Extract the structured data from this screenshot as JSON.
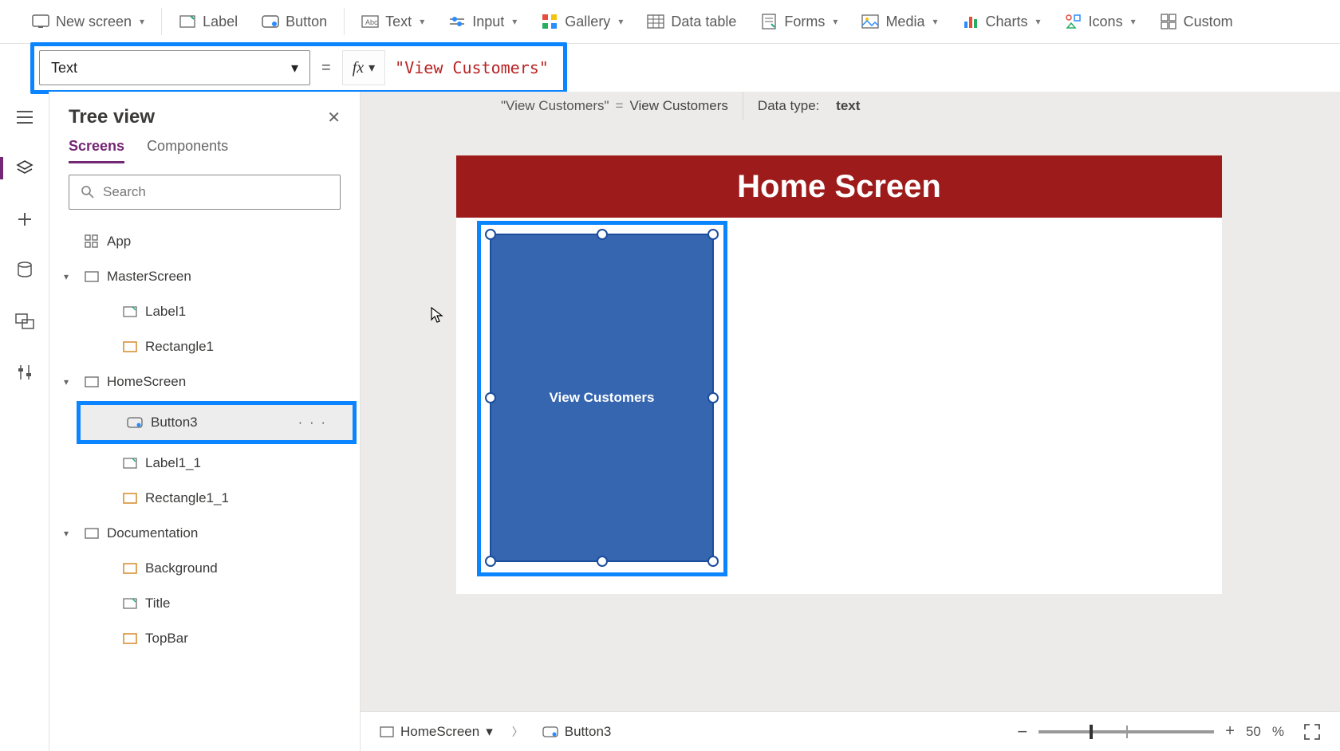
{
  "ribbon": {
    "new_screen": "New screen",
    "label": "Label",
    "button": "Button",
    "text": "Text",
    "input": "Input",
    "gallery": "Gallery",
    "data_table": "Data table",
    "forms": "Forms",
    "media": "Media",
    "charts": "Charts",
    "icons": "Icons",
    "custom": "Custom"
  },
  "formula": {
    "property": "Text",
    "equals": "=",
    "fx": "fx",
    "expression": "\"View Customers\""
  },
  "eval": {
    "left_expr": "\"View Customers\"",
    "eq": "=",
    "left_val": "View Customers",
    "datatype_label": "Data type:",
    "datatype": "text"
  },
  "tree": {
    "title": "Tree view",
    "tabs": {
      "screens": "Screens",
      "components": "Components"
    },
    "search_placeholder": "Search",
    "app": "App",
    "master": "MasterScreen",
    "label1": "Label1",
    "rect1": "Rectangle1",
    "home": "HomeScreen",
    "button3": "Button3",
    "label11": "Label1_1",
    "rect11": "Rectangle1_1",
    "doc": "Documentation",
    "bg": "Background",
    "title_item": "Title",
    "topbar": "TopBar",
    "more": "· · ·"
  },
  "canvas": {
    "header": "Home Screen",
    "button_label": "View Customers"
  },
  "breadcrumb": {
    "screen": "HomeScreen",
    "control": "Button3"
  },
  "zoom": {
    "minus": "−",
    "plus": "+",
    "value": "50",
    "percent": "%"
  }
}
